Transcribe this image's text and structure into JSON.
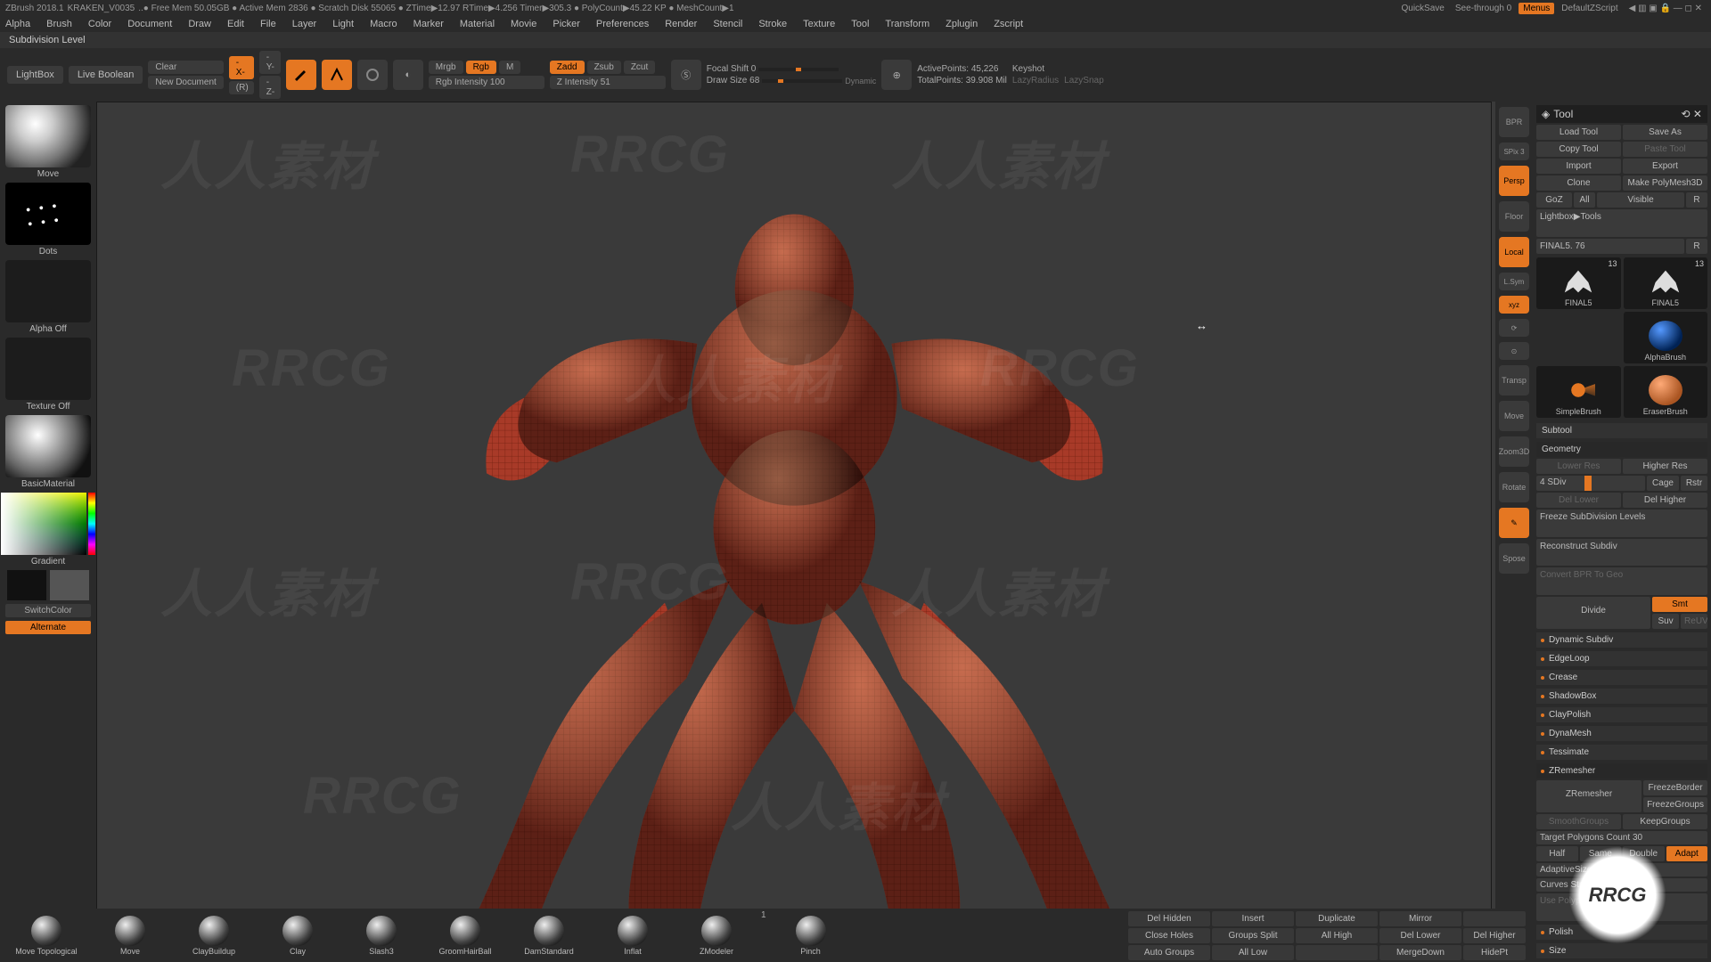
{
  "title": {
    "app": "ZBrush 2018.1",
    "doc": "KRAKEN_V0035",
    "stats": "..● Free Mem 50.05GB ● Active Mem 2836 ● Scratch Disk 55065 ● ZTime▶12.97 RTime▶4.256 Timer▶305.3 ● PolyCount▶45.22 KP ● MeshCount▶1",
    "quicksave": "QuickSave",
    "seethrough": "See-through  0",
    "menus": "Menus",
    "zscript": "DefaultZScript"
  },
  "menus": [
    "Alpha",
    "Brush",
    "Color",
    "Document",
    "Draw",
    "Edit",
    "File",
    "Layer",
    "Light",
    "Macro",
    "Marker",
    "Material",
    "Movie",
    "Picker",
    "Preferences",
    "Render",
    "Stencil",
    "Stroke",
    "Texture",
    "Tool",
    "Transform",
    "Zplugin",
    "Zscript"
  ],
  "secondbar": "Subdivision Level",
  "toolbar": {
    "lightbox": "LightBox",
    "liveboolean": "Live Boolean",
    "clear": "Clear",
    "newdoc": "New Document",
    "mrgb": "Mrgb",
    "rgb": "Rgb",
    "m": "M",
    "rgbint": "Rgb Intensity 100",
    "zadd": "Zadd",
    "zsub": "Zsub",
    "zcut": "Zcut",
    "zint": "Z Intensity 51",
    "focal": "Focal Shift 0",
    "drawsize": "Draw Size 68",
    "dynamic": "Dynamic",
    "activepoints": "ActivePoints: 45,226",
    "totalpoints": "TotalPoints: 39.908 Mil",
    "keyshot": "Keyshot",
    "lazyradius": "LazyRadius",
    "lazysnap": "LazySnap"
  },
  "left": {
    "brush": "Move",
    "stroke": "Dots",
    "alpha": "Alpha Off",
    "texture": "Texture Off",
    "material": "BasicMaterial",
    "gradient": "Gradient",
    "switch": "SwitchColor",
    "alternate": "Alternate"
  },
  "right": {
    "bpr": "BPR",
    "spix": "SPix 3",
    "persp": "Persp",
    "floor": "Floor",
    "local": "Local",
    "lsym": "L.Sym",
    "xyz": "xyz",
    "transp": "Transp",
    "move": "Move",
    "zoom": "Zoom3D",
    "rotate": "Rotate",
    "sposo": "Spose"
  },
  "panel": {
    "title": "Tool",
    "row1": {
      "load": "Load Tool",
      "save": "Save As"
    },
    "row2": {
      "copy": "Copy Tool",
      "paste": "Paste Tool"
    },
    "row3": {
      "import": "Import",
      "export": "Export"
    },
    "row4": {
      "clone": "Clone",
      "makepm": "Make PolyMesh3D"
    },
    "row5": {
      "goz": "GoZ",
      "all": "All",
      "visible": "Visible",
      "r": "R"
    },
    "lightbox": "Lightbox▶Tools",
    "final": "FINAL5. 76",
    "finalR": "R",
    "thumbs": [
      {
        "name": "FINAL5",
        "num": "13"
      },
      {
        "name": "FINAL5",
        "num": "13"
      },
      {
        "name": "AlphaBrush",
        "num": ""
      },
      {
        "name": "SimpleBrush",
        "num": ""
      },
      {
        "name": "EraserBrush",
        "num": ""
      }
    ],
    "subtool": "Subtool",
    "geometry": "Geometry",
    "lowres": "Lower Res",
    "highres": "Higher Res",
    "sdiv": "4 SDiv",
    "cage": "Cage",
    "rstr": "Rstr",
    "dellower": "Del Lower",
    "delhigher": "Del Higher",
    "freeze": "Freeze SubDivision Levels",
    "reconstruct": "Reconstruct Subdiv",
    "convertbpr": "Convert BPR To Geo",
    "divide": "Divide",
    "smt": "Smt",
    "suv": "Suv",
    "reuv": "ReUV",
    "dynsub": "Dynamic Subdiv",
    "edgeloop": "EdgeLoop",
    "crease": "Crease",
    "shadowbox": "ShadowBox",
    "claypolish": "ClayPolish",
    "dynamesh": "DynaMesh",
    "tessimate": "Tessimate",
    "zremesher": "ZRemesher",
    "zremesher2": "ZRemesher",
    "freezeborder": "FreezeBorder",
    "freezegroups": "FreezeGroups",
    "smoothgroups": "SmoothGroups",
    "keepgroups": "KeepGroups",
    "targetpoly": "Target Polygons Count 30",
    "half": "Half",
    "same": "Same",
    "double": "Double",
    "adapt": "Adapt",
    "adaptivesize": "AdaptiveSize 50",
    "curvesstrength": "Curves Strength",
    "usepoly": "Use Polypaint",
    "polish": "Polish",
    "size": "Size"
  },
  "bottom": {
    "brushes": [
      "Move Topological",
      "Move",
      "ClayBuildup",
      "Clay",
      "Slash3",
      "GroomHairBall",
      "DamStandard",
      "Inflat",
      "ZModeler",
      "Pinch"
    ],
    "one": "1",
    "grid": {
      "r1": [
        "Del Hidden",
        "Insert",
        "",
        ""
      ],
      "mirror": "Mirror",
      "r2": [
        "Close Holes",
        "Groups Split",
        "Duplicate",
        ""
      ],
      "r3": [
        "Auto Groups",
        "All Low",
        "All High",
        "Del Lower",
        "Del Higher"
      ],
      "r4": [
        "",
        "",
        "",
        "MergeDown",
        "HidePt"
      ]
    }
  }
}
